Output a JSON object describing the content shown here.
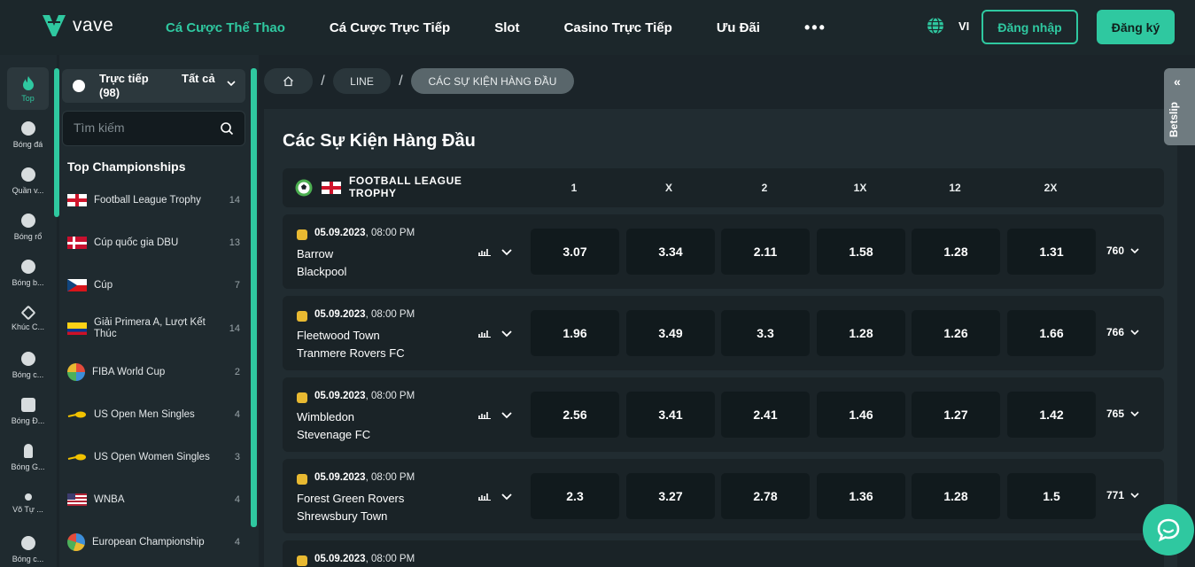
{
  "header": {
    "logo_text": "vave",
    "nav": [
      {
        "label": "Cá Cược Thể Thao",
        "active": true
      },
      {
        "label": "Cá Cược Trực Tiếp",
        "active": false
      },
      {
        "label": "Slot",
        "active": false
      },
      {
        "label": "Casino Trực Tiếp",
        "active": false
      },
      {
        "label": "Ưu Đãi",
        "active": false
      }
    ],
    "more": "•••",
    "lang": "VI",
    "login": "Đăng nhập",
    "register": "Đăng ký"
  },
  "rail": {
    "items": [
      {
        "label": "Top",
        "icon": "flame-icon"
      },
      {
        "label": "Bóng đá",
        "icon": "soccer-ball-icon"
      },
      {
        "label": "Quần v...",
        "icon": "tennis-ball-icon"
      },
      {
        "label": "Bóng rổ",
        "icon": "basketball-icon"
      },
      {
        "label": "Bóng b...",
        "icon": "table-tennis-icon"
      },
      {
        "label": "Khúc C...",
        "icon": "hockey-sticks-icon"
      },
      {
        "label": "Bóng c...",
        "icon": "volleyball-icon"
      },
      {
        "label": "Bóng Đ...",
        "icon": "esports-soccer-icon"
      },
      {
        "label": "Bóng G...",
        "icon": "badminton-icon"
      },
      {
        "label": "Võ Tự ...",
        "icon": "martial-arts-icon"
      },
      {
        "label": "Bóng c...",
        "icon": "baseball-icon"
      }
    ]
  },
  "panel": {
    "live_label": "Trực tiếp (98)",
    "all_label": "Tất cả",
    "search_placeholder": "Tìm kiếm",
    "top_title": "Top Championships",
    "championships": [
      {
        "name": "Football League Trophy",
        "count": "14",
        "flag": "england"
      },
      {
        "name": "Cúp quốc gia DBU",
        "count": "13",
        "flag": "denmark"
      },
      {
        "name": "Cúp",
        "count": "7",
        "flag": "czech"
      },
      {
        "name": "Giải Primera A, Lượt Kết Thúc",
        "count": "14",
        "flag": "colombia"
      },
      {
        "name": "FIBA World Cup",
        "count": "2",
        "flag": "globe"
      },
      {
        "name": "US Open Men Singles",
        "count": "4",
        "flag": "tennis"
      },
      {
        "name": "US Open Women Singles",
        "count": "3",
        "flag": "tennis"
      },
      {
        "name": "WNBA",
        "count": "4",
        "flag": "usa"
      },
      {
        "name": "European Championship",
        "count": "4",
        "flag": "globe"
      }
    ]
  },
  "breadcrumb": {
    "line": "LINE",
    "current": "CÁC SỰ KIỆN HÀNG ĐẦU",
    "sep": "/"
  },
  "main": {
    "title": "Các Sự Kiện Hàng Đầu",
    "league": "FOOTBALL LEAGUE TROPHY",
    "columns": [
      "1",
      "X",
      "2",
      "1X",
      "12",
      "2X"
    ],
    "events": [
      {
        "date": "05.09.2023",
        "time": ", 08:00 PM",
        "home": "Barrow",
        "away": "Blackpool",
        "odds": [
          "3.07",
          "3.34",
          "2.11",
          "1.58",
          "1.28",
          "1.31"
        ],
        "more": "760"
      },
      {
        "date": "05.09.2023",
        "time": ", 08:00 PM",
        "home": "Fleetwood Town",
        "away": "Tranmere Rovers FC",
        "odds": [
          "1.96",
          "3.49",
          "3.3",
          "1.28",
          "1.26",
          "1.66"
        ],
        "more": "766"
      },
      {
        "date": "05.09.2023",
        "time": ", 08:00 PM",
        "home": "Wimbledon",
        "away": "Stevenage FC",
        "odds": [
          "2.56",
          "3.41",
          "2.41",
          "1.46",
          "1.27",
          "1.42"
        ],
        "more": "765"
      },
      {
        "date": "05.09.2023",
        "time": ", 08:00 PM",
        "home": "Forest Green Rovers",
        "away": "Shrewsbury Town",
        "odds": [
          "2.3",
          "3.27",
          "2.78",
          "1.36",
          "1.28",
          "1.5"
        ],
        "more": "771"
      },
      {
        "date": "05.09.2023",
        "time": ", 08:00 PM",
        "home": "",
        "away": "",
        "odds": [
          "",
          "",
          "",
          "",
          "",
          ""
        ],
        "more": ""
      }
    ]
  },
  "betslip": {
    "label": "Betslip"
  },
  "colors": {
    "accent": "#2fc8a0",
    "bg": "#1b2429",
    "odd_bg": "#111a1d"
  }
}
